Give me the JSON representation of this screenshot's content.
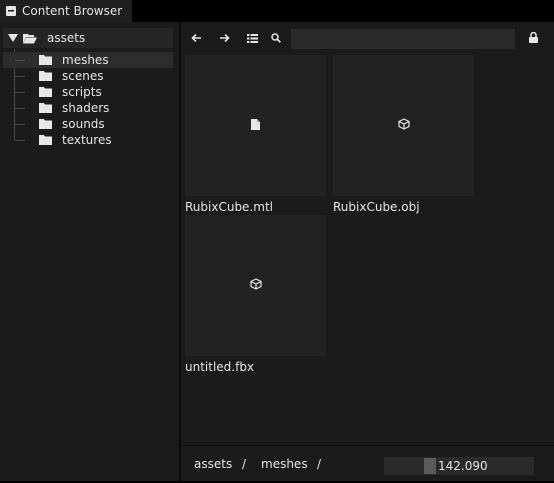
{
  "window": {
    "tab_title": "Content Browser",
    "tab_icon": "window-icon"
  },
  "tree": {
    "root": {
      "label": "assets",
      "expanded": true,
      "icon": "folder-open-icon"
    },
    "items": [
      {
        "label": "meshes",
        "selected": true,
        "icon": "folder-icon"
      },
      {
        "label": "scenes",
        "icon": "folder-icon"
      },
      {
        "label": "scripts",
        "icon": "folder-icon"
      },
      {
        "label": "shaders",
        "icon": "folder-icon"
      },
      {
        "label": "sounds",
        "icon": "folder-icon"
      },
      {
        "label": "textures",
        "icon": "folder-icon"
      }
    ]
  },
  "toolbar": {
    "back_icon": "arrow-left-icon",
    "forward_icon": "arrow-right-icon",
    "list_icon": "list-view-icon",
    "search_icon": "search-icon",
    "search_value": "",
    "lock_icon": "lock-icon"
  },
  "assets": [
    {
      "name": "RubixCube.mtl",
      "icon": "file-icon"
    },
    {
      "name": "RubixCube.obj",
      "icon": "mesh-icon"
    },
    {
      "name": "untitled.fbx",
      "icon": "mesh-icon"
    }
  ],
  "breadcrumb": {
    "items": [
      "assets",
      "meshes"
    ],
    "separator": "/"
  },
  "zoom": {
    "value": "142.090"
  },
  "colors": {
    "background": "#1b1b1b",
    "thumbnail": "#222222",
    "text": "#e6e6e6"
  }
}
